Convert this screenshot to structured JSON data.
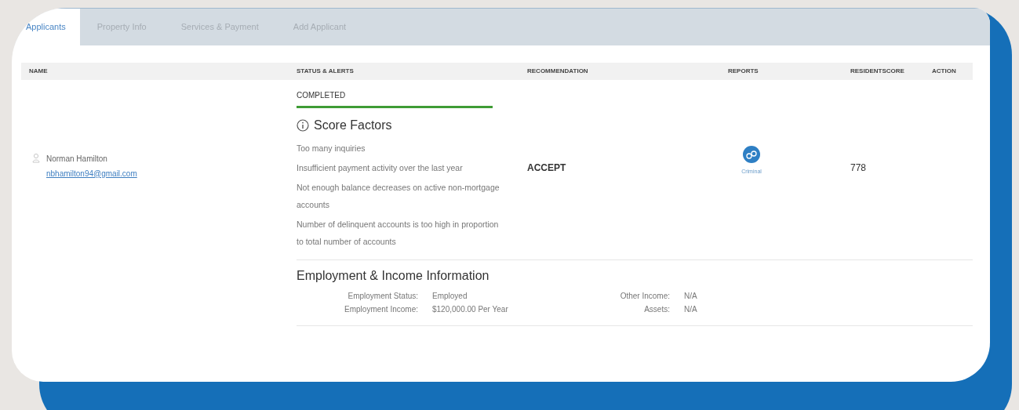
{
  "tabs": [
    {
      "label": "Applicants",
      "selected": true
    },
    {
      "label": "Property Info",
      "selected": false
    },
    {
      "label": "Services & Payment",
      "selected": false
    },
    {
      "label": "Add Applicant",
      "selected": false
    }
  ],
  "table": {
    "columns": [
      "NAME",
      "STATUS & ALERTS",
      "RECOMMENDATION",
      "REPORTS",
      "RESIDENTSCORE",
      "ACTION"
    ],
    "rows": [
      {
        "name": "Norman Hamilton",
        "email": "nbhamilton94@gmail.com",
        "status": "COMPLETED",
        "level": 1,
        "score_factors_title": "Score Factors",
        "score_factors": [
          "Too many inquiries",
          "Insufficient payment activity over the last year",
          "Not enough balance decreases on active non-mortgage accounts",
          "Number of delinquent accounts is too high in proportion to total number of accounts"
        ],
        "recommendation": "ACCEPT",
        "report": "Criminal",
        "residentscore": "778",
        "employment": {
          "title": "Employment & Income Information",
          "fields": [
            {
              "label": "Employment Status:",
              "value": "Employed"
            },
            {
              "label": "Other Income:",
              "value": "N/A"
            },
            {
              "label": "Employment Income:",
              "value": "$120,000.00 Per Year"
            },
            {
              "label": "Assets:",
              "value": "N/A"
            }
          ]
        }
      }
    ]
  }
}
